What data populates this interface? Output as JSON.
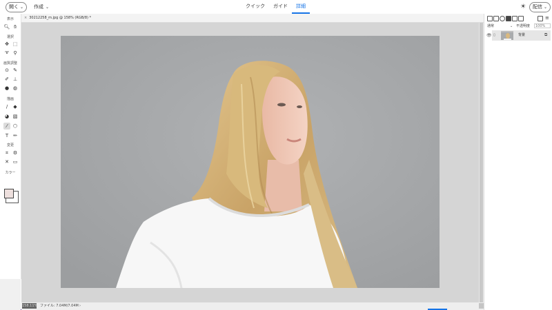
{
  "topbar": {
    "open_label": "開く",
    "create_label": "作成",
    "modes": [
      "クイック",
      "ガイド",
      "詳細"
    ],
    "active_mode": "詳細",
    "share_label": "配信"
  },
  "tools": {
    "sections": [
      "表示",
      "選択",
      "画質調整",
      "描画",
      "変更",
      "カラー"
    ]
  },
  "document": {
    "tab_label": "30212258_m.jpg @ 158% (RGB/8)",
    "tab_modified": "*",
    "zoom": "158.11%",
    "file_info": "ファイル: 7.04M/7.04M"
  },
  "layers": {
    "blend_mode": "通常",
    "opacity_label": "不透明度",
    "opacity_value": "100%",
    "items": [
      {
        "name": "背景"
      }
    ]
  },
  "colors": {
    "accent": "#1473e6",
    "foreground_swatch": "#eee0de",
    "background_swatch": "#ffffff"
  }
}
